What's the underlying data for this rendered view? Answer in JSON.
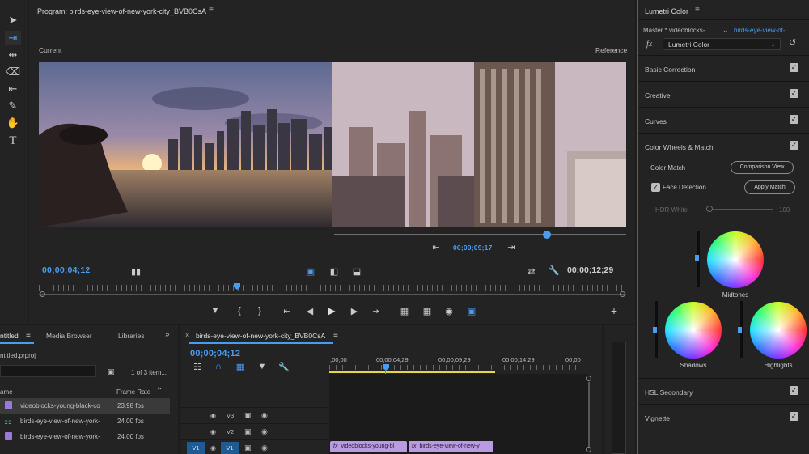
{
  "program": {
    "title": "Program: birds-eye-view-of-new-york-city_BVB0CsA",
    "current_label": "Current",
    "reference_label": "Reference",
    "ref_timecode": "00;00;09;17",
    "current_timecode": "00;00;04;12",
    "duration": "00;00;12;29"
  },
  "lumetri": {
    "title": "Lumetri Color",
    "master": "Master * videoblocks-...",
    "clip": "birds-eye-view-of-...",
    "effect": "Lumetri Color",
    "sections": [
      "Basic Correction",
      "Creative",
      "Curves",
      "Color Wheels & Match",
      "HSL Secondary",
      "Vignette"
    ],
    "color_match": "Color Match",
    "comparison_view": "Comparison View",
    "face_detection": "Face Detection",
    "apply_match": "Apply Match",
    "hdr_white": "HDR White",
    "hdr_value": "100",
    "midtones": "Midtones",
    "shadows": "Shadows",
    "highlights": "Highlights"
  },
  "project": {
    "tabs": [
      "ntitled",
      "Media Browser",
      "Libraries"
    ],
    "file": "ntitled.prproj",
    "items_count": "1 of 3 item...",
    "col_name": "ame",
    "col_rate": "Frame Rate",
    "rows": [
      {
        "name": "videoblocks-young-black-co",
        "rate": "23.98 fps",
        "color": "#9a7ad8"
      },
      {
        "name": "birds-eye-view-of-new-york-",
        "rate": "24.00 fps",
        "color": "#2fa59b"
      },
      {
        "name": "birds-eye-view-of-new-york-",
        "rate": "24.00 fps",
        "color": "#9a7ad8"
      }
    ]
  },
  "timeline": {
    "tab": "birds-eye-view-of-new-york-city_BVB0CsA",
    "timecode": "00;00;04;12",
    "ruler": [
      ";00;00",
      "00;00;04;29",
      "00;00;09;29",
      "00;00;14;29",
      "00;00"
    ],
    "tracks": [
      "V3",
      "V2",
      "V1"
    ],
    "src": "V1",
    "clips": [
      "videoblocks-young-bl",
      "birds-eye-view-of-new-y"
    ]
  }
}
